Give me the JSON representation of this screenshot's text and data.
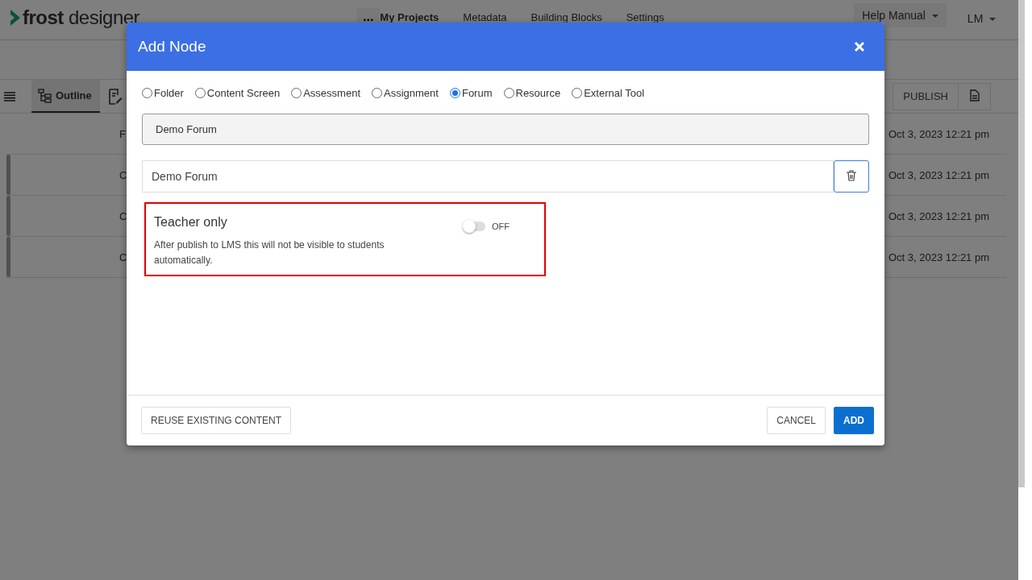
{
  "app": {
    "logo": "**frost** designer",
    "more": "...",
    "nav": [
      {
        "label": "My Projects",
        "selected": true
      },
      {
        "label": "Metadata",
        "selected": false
      },
      {
        "label": "Building Blocks",
        "selected": false
      },
      {
        "label": "Settings",
        "selected": false
      }
    ],
    "help": "Help Manual",
    "user": "LM"
  },
  "toolbar": {
    "tabs": [
      {
        "label": "Outline",
        "selected": true
      }
    ],
    "publish": "PUBLISH"
  },
  "rows": [
    {
      "name": "F",
      "date": "Oct 3, 2023 12:21 pm",
      "accent": false
    },
    {
      "name": "C",
      "date": "Oct 3, 2023 12:21 pm",
      "accent": true
    },
    {
      "name": "C",
      "date": "Oct 3, 2023 12:21 pm",
      "accent": true
    },
    {
      "name": "C",
      "date": "Oct 3, 2023 12:21 pm",
      "accent": true
    }
  ],
  "dialog": {
    "title": "Add Node",
    "types": [
      {
        "label": "Folder",
        "selected": false
      },
      {
        "label": "Content Screen",
        "selected": false
      },
      {
        "label": "Assessment",
        "selected": false
      },
      {
        "label": "Assignment",
        "selected": false
      },
      {
        "label": "Forum",
        "selected": true
      },
      {
        "label": "Resource",
        "selected": false
      },
      {
        "label": "External Tool",
        "selected": false
      }
    ],
    "field_1": {
      "value": "Demo Forum"
    },
    "field_2": {
      "value": "Demo Forum"
    },
    "teacher_only": {
      "title": "Teacher only",
      "description": "After publish to LMS this will not be visible to students automatically.",
      "on": false,
      "state_label": "OFF"
    },
    "buttons": {
      "reuse": "REUSE EXISTING CONTENT",
      "cancel": "CANCEL",
      "add": "ADD"
    }
  }
}
